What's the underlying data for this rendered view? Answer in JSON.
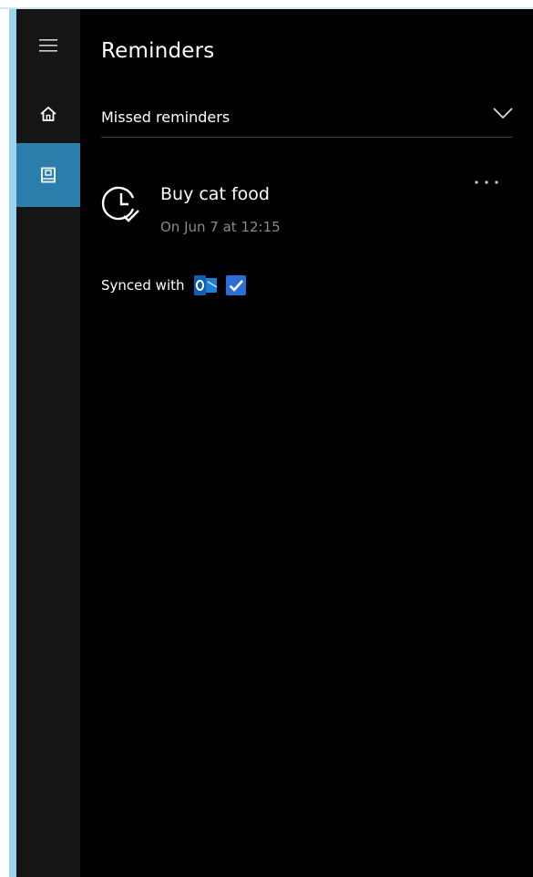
{
  "header": {
    "title": "Reminders"
  },
  "section": {
    "label": "Missed reminders"
  },
  "reminder": {
    "title": "Buy cat food",
    "time": "On Jun 7 at 12:15",
    "icon": "clock-check-icon"
  },
  "sync": {
    "label": "Synced with",
    "service_icon": "outlook-icon",
    "checked": true
  },
  "nav": {
    "items": [
      "hamburger-icon",
      "home-icon",
      "notebook-icon"
    ]
  },
  "colors": {
    "background": "#000000",
    "rail": "#151515",
    "accent": "#2a7eac",
    "muted_text": "#8a8a8a",
    "checkbox": "#2b6fd6"
  }
}
